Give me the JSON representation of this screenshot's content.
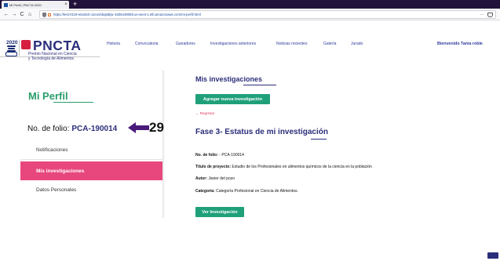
{
  "browser": {
    "tab_title": "Mi Perfil | PNCTA 2020",
    "tab_close": "×",
    "new_tab": "+",
    "url": "https://test-0119-elasticb-11eovbbq6dtjw-1505449058.us-west-1.elb.amazonaws.com/mi-perfil.html",
    "back": "←",
    "forward": "→",
    "reload": "C",
    "home": "⌂",
    "more": "···"
  },
  "logo": {
    "year": "2020",
    "title": "PNCTA",
    "subtitle_line1": "Premio Nacional en Ciencia",
    "subtitle_line2": "y Tecnología de Alimentos"
  },
  "menu": [
    "Historia",
    "Convocatoria",
    "Ganadores",
    "Investigaciones anteriores",
    "Noticias recientes",
    "Galería",
    "Jurado"
  ],
  "welcome": "Bienvenido Tania roble",
  "sidebar": {
    "title": "Mi Perfil",
    "folio_label": "No. de folio:",
    "folio_value": "PCA-190014",
    "annotation_number": "29",
    "items": [
      {
        "label": "Notificaciones",
        "active": false
      },
      {
        "label": "Mis investigaciones",
        "active": true
      },
      {
        "label": "Datos Personales",
        "active": false
      }
    ]
  },
  "main": {
    "title": "Mis investigaciones",
    "add_button": "Agregar nueva investigación",
    "back_link": "← Regresar",
    "fase_title": "Fase 3- Estatus de mi investigación",
    "details": {
      "folio_label": "No. de folio:",
      "folio_value": "- PCA-190014",
      "project_label": "Título de proyecto:",
      "project_value": "Estudio de los Profesionales en alimentos químicos de la ciencia en la población",
      "author_label": "Autor:",
      "author_value": "Javier del pozo",
      "category_label": "Categoría:",
      "category_value": "Categoría Profesional en Ciencia de Alimentos."
    },
    "view_button": "Ver Investigación"
  },
  "colors": {
    "brand_navy": "#2b2e7a",
    "accent_green": "#1fa07a",
    "accent_pink": "#e8477e",
    "logo_red": "#d61f3f",
    "annotation_arrow": "#4a1a7a"
  }
}
